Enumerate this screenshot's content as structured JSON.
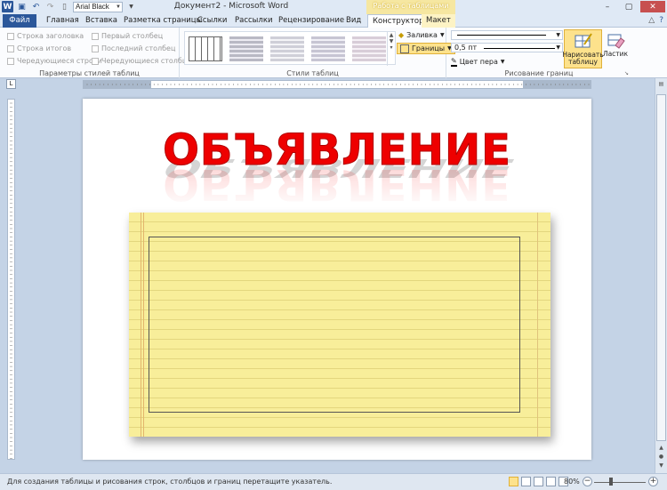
{
  "title_bar": {
    "window_title": "Документ2 - Microsoft Word",
    "context_title": "Работа с таблицами",
    "font_name": "Arial Black",
    "qat_icons": [
      "word-logo",
      "save-icon",
      "undo-icon",
      "redo-icon",
      "new-doc-icon"
    ]
  },
  "tabs": {
    "file": "Файл",
    "home": "Главная",
    "insert": "Вставка",
    "page_layout": "Разметка страницы",
    "references": "Ссылки",
    "mailings": "Рассылки",
    "review": "Рецензирование",
    "view": "Вид",
    "design": "Конструктор",
    "layout": "Макет"
  },
  "ribbon": {
    "style_options": {
      "header_row": "Строка заголовка",
      "total_row": "Строка итогов",
      "banded_rows": "Чередующиеся строки",
      "first_column": "Первый столбец",
      "last_column": "Последний столбец",
      "banded_columns": "Чередующиеся столбцы",
      "group_label": "Параметры стилей таблиц"
    },
    "table_styles": {
      "group_label": "Стили таблиц",
      "shading": "Заливка",
      "borders": "Границы"
    },
    "draw_borders": {
      "pen_weight": "0,5 пт",
      "pen_color": "Цвет пера",
      "draw_table": "Нарисовать таблицу",
      "eraser": "Ластик",
      "group_label": "Рисование границ"
    }
  },
  "document": {
    "headline": "ОБЪЯВЛЕНИЕ"
  },
  "status_bar": {
    "hint": "Для создания таблицы и рисования строк, столбцов и границ перетащите указатель.",
    "zoom": "80%"
  },
  "colors": {
    "accent": "#2b579a",
    "headline": "#ee0000",
    "notepad": "#f8ee9a",
    "highlight": "#fde28c"
  }
}
